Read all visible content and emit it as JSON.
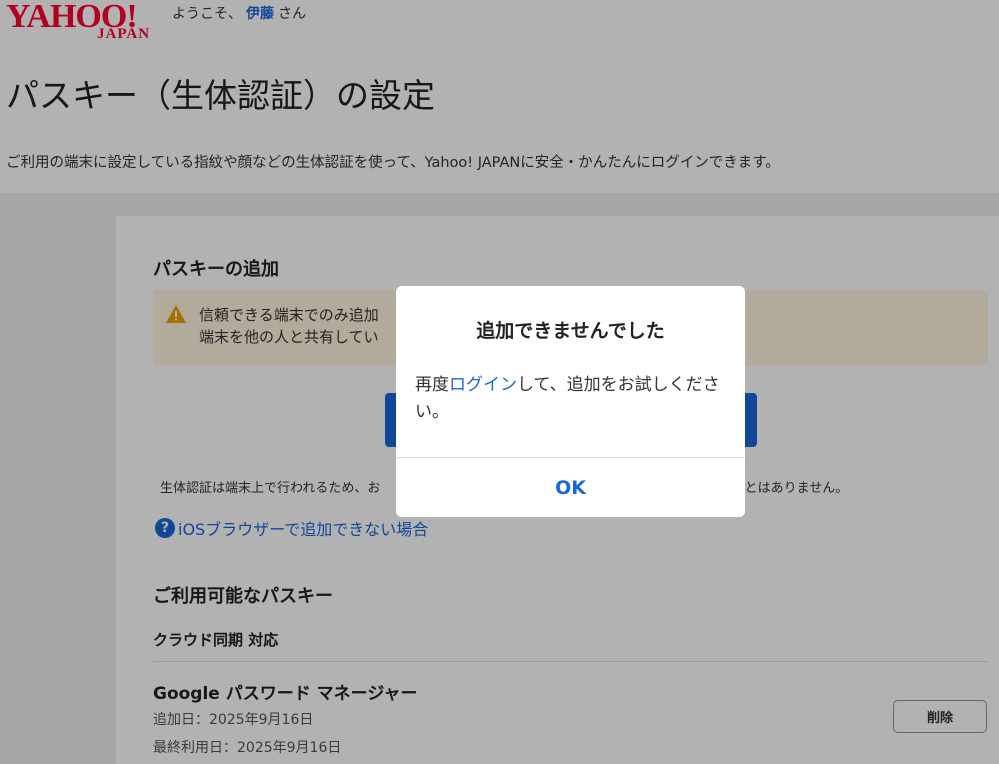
{
  "header": {
    "logo_main": "YAHOO!",
    "logo_sub": "JAPAN",
    "welcome_prefix": "ようこそ、",
    "user_name": "伊藤",
    "welcome_suffix": "さん"
  },
  "page": {
    "title": "パスキー（生体認証）の設定",
    "description": "ご利用の端末に設定している指紋や顔などの生体認証を使って、Yahoo! JAPANに安全・かんたんにログインできます。"
  },
  "add_section": {
    "title": "パスキーの追加",
    "warning_line1": "信頼できる端末でのみ追加",
    "warning_line2": "端末を他の人と共有してい",
    "warning_icon": "warning-triangle-icon",
    "biometric_note_left": "生体認証は端末上で行われるため、お",
    "biometric_note_right": "とはありません。",
    "help_link": "iOSブラウザーで追加できない場合",
    "help_icon": "question-circle-icon"
  },
  "available_section": {
    "title": "ご利用可能なパスキー",
    "subtitle": "クラウド同期 対応",
    "passkeys": [
      {
        "name": "Google パスワード マネージャー",
        "added": "追加日：2025年9月16日",
        "last_used": "最終利用日：2025年9月16日",
        "delete_label": "削除"
      }
    ]
  },
  "modal": {
    "title": "追加できませんでした",
    "body_prefix": "再度",
    "body_link": "ログイン",
    "body_suffix": "して、追加をお試しください。",
    "ok_label": "OK"
  },
  "colors": {
    "brand": "#ff0033",
    "link": "#1a66d9",
    "warning_bg": "#fff4dd",
    "warning_icon": "#f0a10a"
  }
}
